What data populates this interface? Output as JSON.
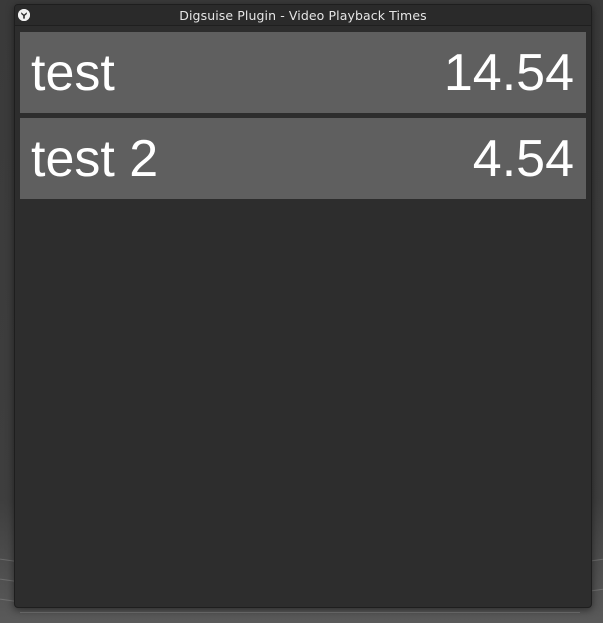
{
  "window": {
    "title": "Digsuise Plugin - Video Playback Times",
    "icon": "app-logo-icon"
  },
  "rows": [
    {
      "name": "test",
      "time": "14.54"
    },
    {
      "name": "test 2",
      "time": "4.54"
    }
  ],
  "colors": {
    "window_bg": "#2d2d2d",
    "row_bg": "#5f5f5f",
    "text": "#ffffff"
  }
}
